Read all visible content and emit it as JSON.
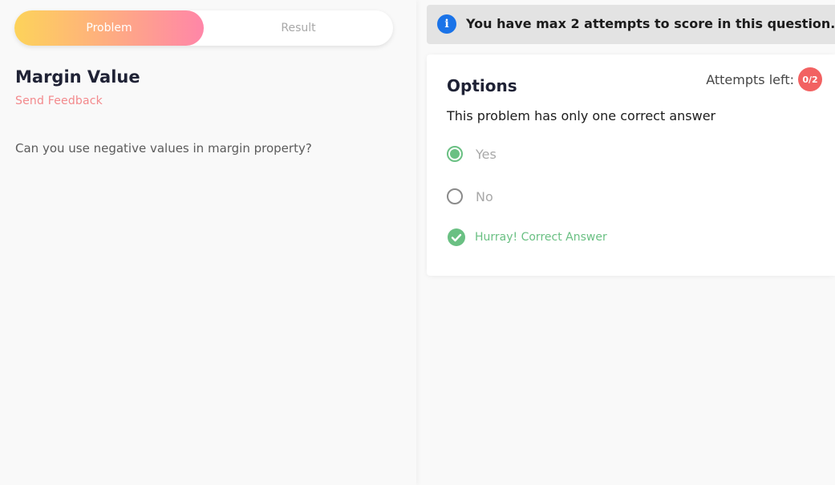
{
  "tabs": {
    "problem": "Problem",
    "result": "Result"
  },
  "problem": {
    "title": "Margin Value",
    "feedback_link": "Send Feedback",
    "question": "Can you use negative values in margin property?"
  },
  "banner": {
    "icon": "info-icon",
    "text": "You have max 2 attempts to score in this question."
  },
  "options_card": {
    "title": "Options",
    "attempts_label": "Attempts left:",
    "attempts_value": "0/2",
    "subtitle": "This problem has only one correct answer",
    "options": [
      {
        "label": "Yes",
        "selected": true
      },
      {
        "label": "No",
        "selected": false
      }
    ],
    "result_message": "Hurray! Correct Answer"
  },
  "colors": {
    "accent_gradient_start": "#fdd35a",
    "accent_gradient_end": "#ff86a8",
    "success": "#6ac083",
    "badge": "#f26262",
    "link": "#f3898c",
    "info": "#1a73e8"
  }
}
